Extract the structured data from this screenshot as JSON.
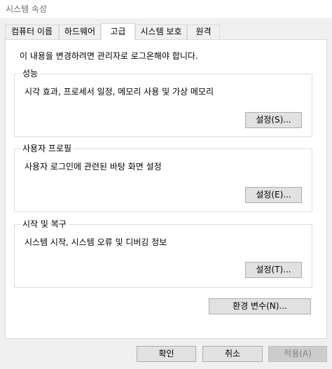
{
  "window": {
    "title": "시스템 속성"
  },
  "tabs": [
    {
      "label": "컴퓨터 이름",
      "active": false
    },
    {
      "label": "하드웨어",
      "active": false
    },
    {
      "label": "고급",
      "active": true
    },
    {
      "label": "시스템 보호",
      "active": false
    },
    {
      "label": "원격",
      "active": false
    }
  ],
  "panel": {
    "intro": "이 내용을 변경하려면 관리자로 로그온해야 합니다.",
    "performance": {
      "title": "성능",
      "description": "시각 효과, 프로세서 일정, 메모리 사용 및 가상 메모리",
      "button": "설정(S)..."
    },
    "user_profile": {
      "title": "사용자 프로필",
      "description": "사용자 로그인에 관련된 바탕 화면 설정",
      "button": "설정(E)..."
    },
    "startup_recovery": {
      "title": "시작 및 복구",
      "description": "시스템 시작, 시스템 오류 및 디버깅 정보",
      "button": "설정(T)..."
    },
    "env_button": "환경 변수(N)..."
  },
  "footer": {
    "ok": "확인",
    "cancel": "취소",
    "apply": "적용(A)"
  }
}
